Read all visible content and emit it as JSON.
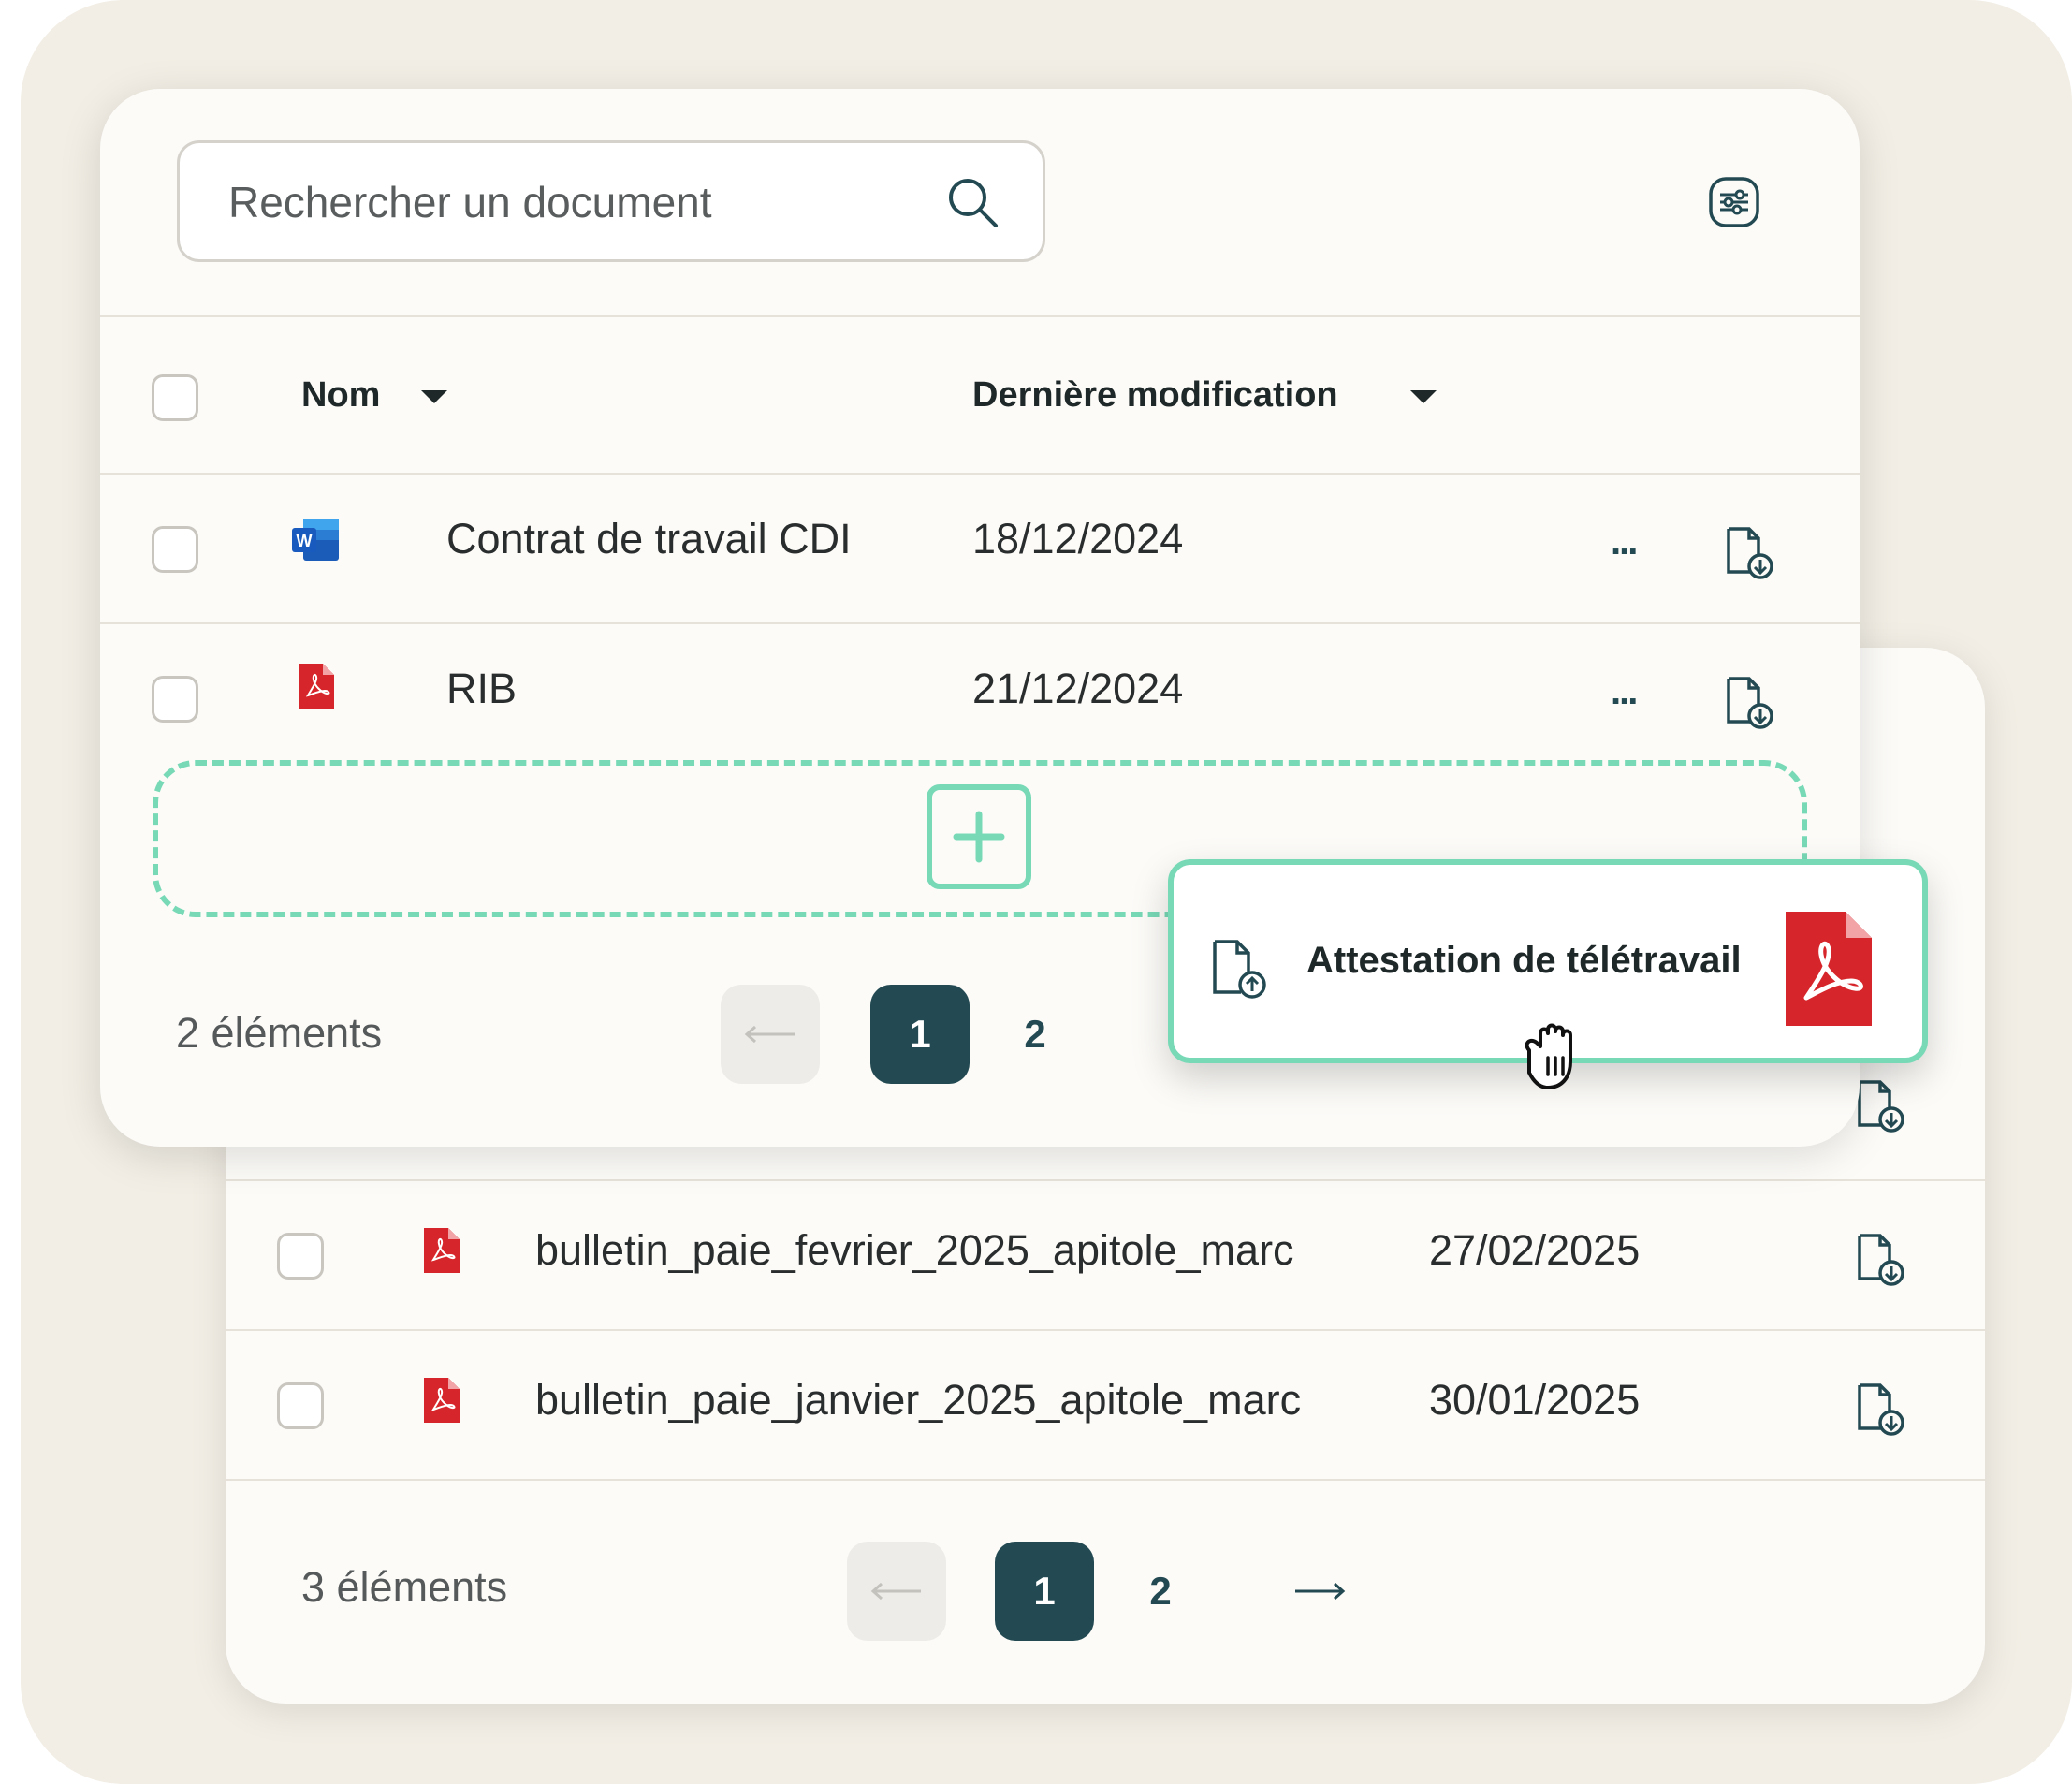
{
  "colors": {
    "accent_dark": "#234a52",
    "dropzone_green": "#78d9b7",
    "pdf_red": "#d7262b",
    "word_blue": "#1b5cb8"
  },
  "front_card": {
    "search": {
      "placeholder": "Rechercher un document",
      "icon": "search-icon"
    },
    "filter_icon": "filter-sliders-icon",
    "columns": {
      "name": "Nom",
      "modified": "Dernière modification"
    },
    "rows": [
      {
        "icon": "word-file-icon",
        "name": "Contrat de travail CDI",
        "date": "18/12/2024",
        "more": "...",
        "download_icon": "download-file-icon"
      },
      {
        "icon": "pdf-file-icon",
        "name": "RIB",
        "date": "21/12/2024",
        "more": "...",
        "download_icon": "download-file-icon"
      }
    ],
    "footer": {
      "count": "2 éléments",
      "current_page": "1",
      "next_page": "2"
    }
  },
  "back_card": {
    "rows": [
      {
        "icon": "pdf-file-icon",
        "name": "bulletin_paie_fevrier_2025_apitole_marc",
        "date": "27/02/2025"
      },
      {
        "icon": "pdf-file-icon",
        "name": "bulletin_paie_janvier_2025_apitole_marc",
        "date": "30/01/2025"
      }
    ],
    "footer": {
      "count": "3 éléments",
      "current_page": "1",
      "next_page": "2"
    }
  },
  "dragged_file": {
    "name": "Attestation de télétravail",
    "icon": "pdf-file-icon",
    "upload_icon": "upload-file-icon",
    "cursor": "grab-hand-icon"
  }
}
